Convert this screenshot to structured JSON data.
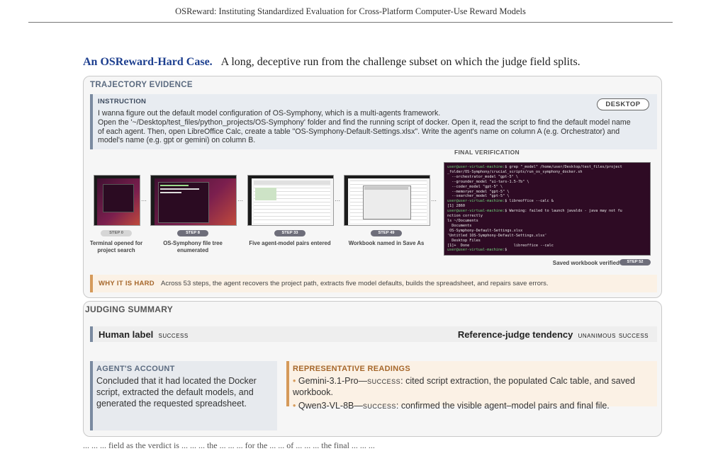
{
  "header": {
    "running_title": "OSReward: Instituting Standardized Evaluation for Cross-Platform Computer-Use Reward Models"
  },
  "caption": {
    "title": "An OSReward-Hard Case.",
    "text": "A long, deceptive run from the challenge subset on which the judge field splits."
  },
  "trajectory": {
    "panel_title": "TRAJECTORY EVIDENCE",
    "instruction_title": "INSTRUCTION",
    "platform_badge": "DESKTOP",
    "instruction_lines": [
      "I wanna figure out the default model configuration of OS-Symphony, which is a multi-agents framework.",
      "Open the '~/Desktop/test_files/python_projects/OS-Symphony' folder and find the running script of docker.  Open it, read the script to find the default model name",
      "of each agent.  Then, open LibreOffice Calc, create a table \"OS-Symphony-Default-Settings.xlsx\".  Write the agent's name on column A (e.g. Orchestrator) and",
      "model's name (e.g. gpt or gemini) on column B."
    ],
    "final_verification_title": "FINAL VERIFICATION",
    "steps": [
      {
        "label": "STEP 0",
        "caption": "Terminal opened for project search"
      },
      {
        "label": "STEP 8",
        "caption": "OS-Symphony file tree enumerated"
      },
      {
        "label": "STEP 33",
        "caption": "Five agent-model pairs entered"
      },
      {
        "label": "STEP 49",
        "caption": "Workbook named in Save As"
      }
    ],
    "final_step": {
      "label": "STEP 52",
      "caption": "Saved workbook verified"
    },
    "terminal_lines": [
      {
        "prompt": "user@user-virtual-machine:",
        "text": "$ grep \"_model\" /home/user/Desktop/test_files/project"
      },
      {
        "prompt": "",
        "text": "_folder/OS-Symphony/crucial_scripts/run_os_symphony_docker.sh"
      },
      {
        "prompt": "",
        "text": "  --orchestrator_model \"gpt-5\" \\"
      },
      {
        "prompt": "",
        "text": "  --grounder_model \"ui-tars-1.5-7b\" \\"
      },
      {
        "prompt": "",
        "text": "  --coder_model \"gpt-5\" \\"
      },
      {
        "prompt": "",
        "text": "  --memoryer_model \"gpt-5\" \\"
      },
      {
        "prompt": "",
        "text": "  --searcher_model \"gpt-5\" \\"
      },
      {
        "prompt": "user@user-virtual-machine:",
        "text": "$ libreoffice --calc &"
      },
      {
        "prompt": "",
        "text": "[1] 2860"
      },
      {
        "prompt": "user@user-virtual-machine:",
        "text": "$ Warning: failed to launch javaldx - java may not fu"
      },
      {
        "prompt": "",
        "text": "nction correctly"
      },
      {
        "prompt": "",
        "text": "ls ~/Documents"
      },
      {
        "prompt": "",
        "text": "  Documents"
      },
      {
        "prompt": "",
        "text": " OS-Symphony-Default-Settings.xlsx"
      },
      {
        "prompt": "",
        "text": "'Untitled 1OS-Symphony-Default-Settings.xlsx'"
      },
      {
        "prompt": "",
        "text": "  Desktop Files"
      },
      {
        "prompt": "",
        "text": "[1]+  Done                    libreoffice --calc"
      },
      {
        "prompt": "user@user-virtual-machine:",
        "text": "$ "
      }
    ],
    "why_hard_label": "WHY IT IS HARD",
    "why_hard_text": "Across 53 steps, the agent recovers the project path, extracts five model defaults, builds the spreadsheet, and repairs save errors."
  },
  "judging": {
    "panel_title": "JUDGING SUMMARY",
    "human_label_title": "Human label",
    "human_label_value": "success",
    "reference_title": "Reference-judge tendency",
    "reference_value": "unanimous success",
    "agent_account_title": "AGENT'S ACCOUNT",
    "agent_account_text": "Concluded that it had located the Docker script, extracted the default models, and generated the requested spreadsheet.",
    "readings_title": "REPRESENTATIVE READINGS",
    "readings": [
      {
        "judge": "Gemini-3.1-Pro",
        "verdict": "success",
        "text": ": cited script extraction, the populated Calc table, and saved workbook."
      },
      {
        "judge": "Qwen3-VL-8B",
        "verdict": "success",
        "text": ": confirmed the visible agent–model pairs and final file."
      }
    ]
  },
  "footer": {
    "cut_line": "... ... ... field as the verdict is ... ... ... the ... ... ... for the ... ... of ... ... ... the final ... ... ..."
  },
  "colors": {
    "caption_blue": "#1d3f8f",
    "accent_slate": "#7a8aa0",
    "accent_orange": "#d59a5a",
    "terminal_bg": "#2e0b24"
  }
}
